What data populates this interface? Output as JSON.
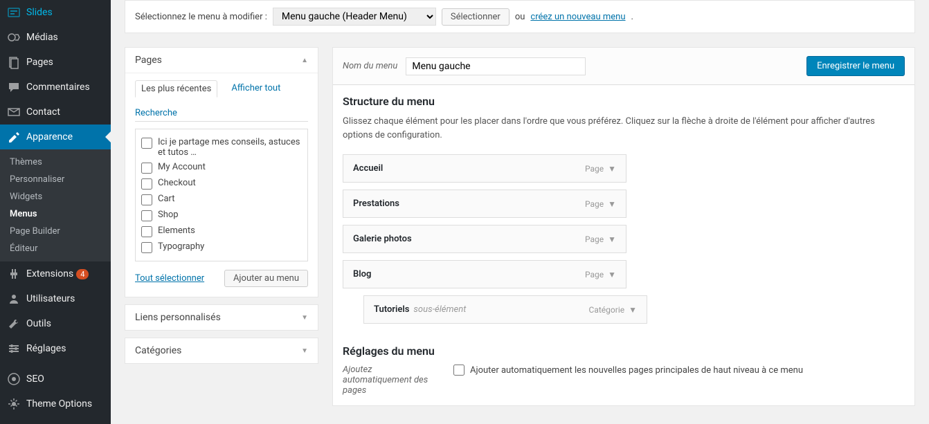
{
  "sidebar": {
    "items": [
      {
        "label": "Slides",
        "icon": "slides"
      },
      {
        "label": "Médias",
        "icon": "media"
      },
      {
        "label": "Pages",
        "icon": "pages"
      },
      {
        "label": "Commentaires",
        "icon": "comments"
      },
      {
        "label": "Contact",
        "icon": "contact"
      },
      {
        "label": "Apparence",
        "icon": "appearance",
        "active": true
      },
      {
        "label": "Extensions",
        "icon": "plugins",
        "badge": "4"
      },
      {
        "label": "Utilisateurs",
        "icon": "users"
      },
      {
        "label": "Outils",
        "icon": "tools"
      },
      {
        "label": "Réglages",
        "icon": "settings"
      },
      {
        "label": "SEO",
        "icon": "seo"
      },
      {
        "label": "Theme Options",
        "icon": "theme-options"
      }
    ],
    "submenu": [
      {
        "label": "Thèmes"
      },
      {
        "label": "Personnaliser"
      },
      {
        "label": "Widgets"
      },
      {
        "label": "Menus",
        "current": true
      },
      {
        "label": "Page Builder"
      },
      {
        "label": "Éditeur"
      }
    ]
  },
  "selectRow": {
    "label": "Sélectionnez le menu à modifier :",
    "selected": "Menu gauche (Header Menu)",
    "button": "Sélectionner",
    "or": "ou",
    "link": "créez un nouveau menu"
  },
  "pagesPanel": {
    "title": "Pages",
    "tabs": {
      "recent": "Les plus récentes",
      "all": "Afficher tout",
      "search": "Recherche"
    },
    "items": [
      "Ici je partage mes conseils, astuces et tutos …",
      "My Account",
      "Checkout",
      "Cart",
      "Shop",
      "Elements",
      "Typography"
    ],
    "selectAll": "Tout sélectionner",
    "addButton": "Ajouter au menu"
  },
  "linksPanel": {
    "title": "Liens personnalisés"
  },
  "catsPanel": {
    "title": "Catégories"
  },
  "menuEdit": {
    "nameLabel": "Nom du menu",
    "nameValue": "Menu gauche",
    "saveButton": "Enregistrer le menu",
    "structureTitle": "Structure du menu",
    "structureDesc": "Glissez chaque élément pour les placer dans l'ordre que vous préférez. Cliquez sur la flèche à droite de l'élément pour afficher d'autres options de configuration.",
    "items": [
      {
        "title": "Accueil",
        "type": "Page"
      },
      {
        "title": "Prestations",
        "type": "Page"
      },
      {
        "title": "Galerie photos",
        "type": "Page"
      },
      {
        "title": "Blog",
        "type": "Page"
      },
      {
        "title": "Tutoriels",
        "type": "Catégorie",
        "sub": true,
        "subLabel": "sous-élément"
      }
    ],
    "settingsTitle": "Réglages du menu",
    "autoAddLabel": "Ajoutez automatiquement des pages",
    "autoAddCheckbox": "Ajouter automatiquement les nouvelles pages principales de haut niveau à ce menu"
  }
}
